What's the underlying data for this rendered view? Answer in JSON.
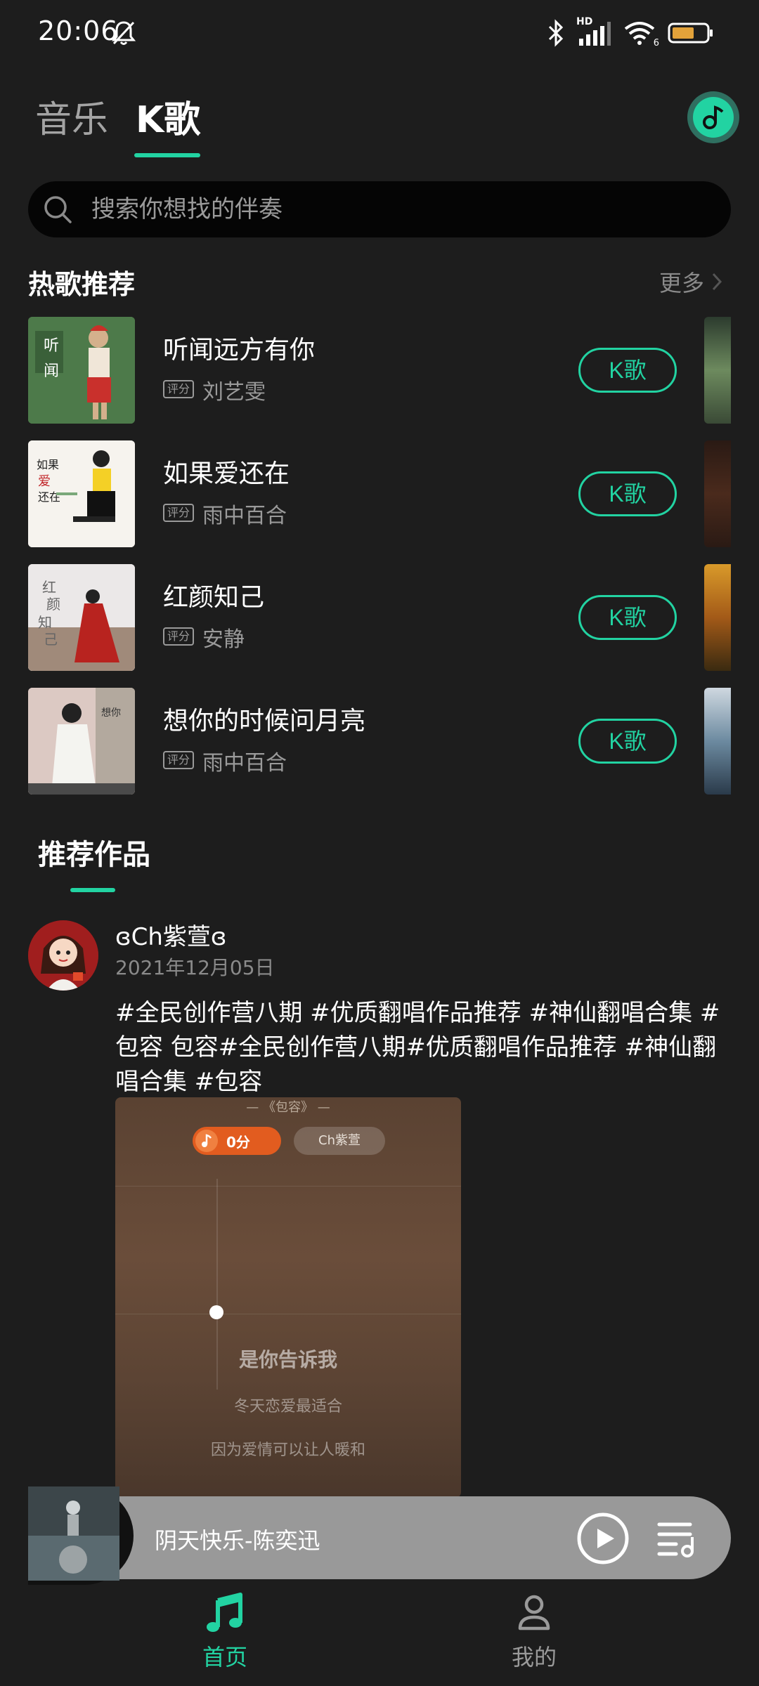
{
  "status_bar": {
    "time": "20:06",
    "network": "HD",
    "signal_sub": "6"
  },
  "top_tabs": [
    {
      "label": "音乐"
    },
    {
      "label": "K歌"
    }
  ],
  "search": {
    "placeholder": "搜索你想找的伴奏"
  },
  "hot_songs": {
    "title": "热歌推荐",
    "more": "更多",
    "score_badge": "评分",
    "button_label": "K歌",
    "items": [
      {
        "title": "听闻远方有你",
        "artist": "刘艺雯"
      },
      {
        "title": "如果爱还在",
        "artist": "雨中百合"
      },
      {
        "title": "红颜知己",
        "artist": "安静"
      },
      {
        "title": "想你的时候问月亮",
        "artist": "雨中百合"
      }
    ]
  },
  "recommended": {
    "title": "推荐作品",
    "post": {
      "username": "ɞCh紫萱ɞ",
      "date": "2021年12月05日",
      "text": "#全民创作营八期 #优质翻唱作品推荐 #神仙翻唱合集 #包容 包容#全民创作营八期#优质翻唱作品推荐 #神仙翻唱合集 #包容",
      "video": {
        "song_label": "—  《包容》  —",
        "score": "0分",
        "singer": "Ch紫萱",
        "lyrics": [
          "是你告诉我",
          "冬天恋爱最适合",
          "因为爱情可以让人暖和"
        ]
      }
    }
  },
  "player": {
    "now_playing": "阴天快乐-陈奕迅"
  },
  "bottom_nav": [
    {
      "label": "首页"
    },
    {
      "label": "我的"
    }
  ],
  "colors": {
    "accent": "#22d3a2",
    "background": "#1d1d1d",
    "search_bg": "#050505",
    "player_bg": "#999999"
  }
}
